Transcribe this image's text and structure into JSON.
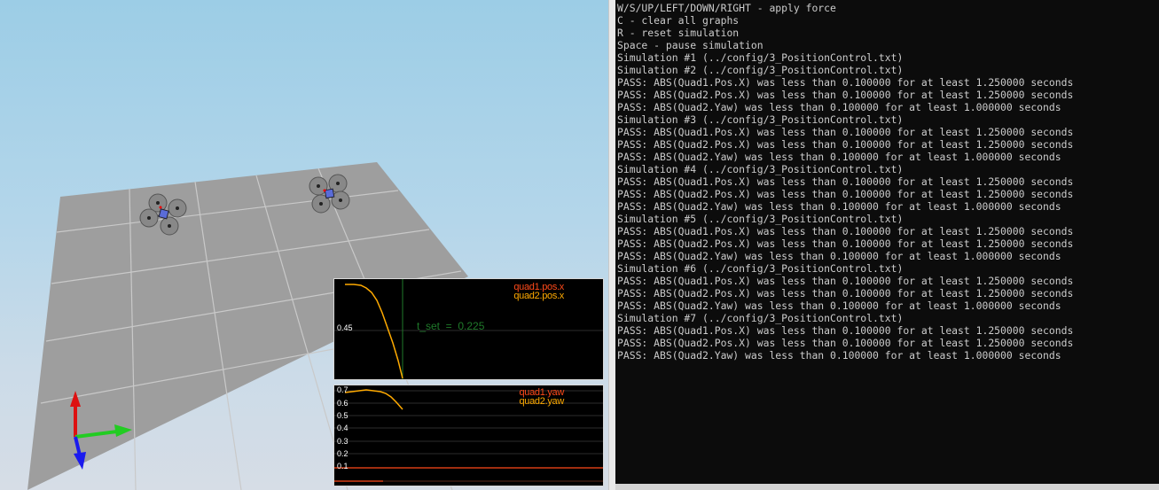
{
  "console": {
    "lines": [
      "W/S/UP/LEFT/DOWN/RIGHT - apply force",
      "C - clear all graphs",
      "R - reset simulation",
      "Space - pause simulation",
      "Simulation #1 (../config/3_PositionControl.txt)",
      "Simulation #2 (../config/3_PositionControl.txt)",
      "PASS: ABS(Quad1.Pos.X) was less than 0.100000 for at least 1.250000 seconds",
      "PASS: ABS(Quad2.Pos.X) was less than 0.100000 for at least 1.250000 seconds",
      "PASS: ABS(Quad2.Yaw) was less than 0.100000 for at least 1.000000 seconds",
      "Simulation #3 (../config/3_PositionControl.txt)",
      "PASS: ABS(Quad1.Pos.X) was less than 0.100000 for at least 1.250000 seconds",
      "PASS: ABS(Quad2.Pos.X) was less than 0.100000 for at least 1.250000 seconds",
      "PASS: ABS(Quad2.Yaw) was less than 0.100000 for at least 1.000000 seconds",
      "Simulation #4 (../config/3_PositionControl.txt)",
      "PASS: ABS(Quad1.Pos.X) was less than 0.100000 for at least 1.250000 seconds",
      "PASS: ABS(Quad2.Pos.X) was less than 0.100000 for at least 1.250000 seconds",
      "PASS: ABS(Quad2.Yaw) was less than 0.100000 for at least 1.000000 seconds",
      "Simulation #5 (../config/3_PositionControl.txt)",
      "PASS: ABS(Quad1.Pos.X) was less than 0.100000 for at least 1.250000 seconds",
      "PASS: ABS(Quad2.Pos.X) was less than 0.100000 for at least 1.250000 seconds",
      "PASS: ABS(Quad2.Yaw) was less than 0.100000 for at least 1.000000 seconds",
      "Simulation #6 (../config/3_PositionControl.txt)",
      "PASS: ABS(Quad1.Pos.X) was less than 0.100000 for at least 1.250000 seconds",
      "PASS: ABS(Quad2.Pos.X) was less than 0.100000 for at least 1.250000 seconds",
      "PASS: ABS(Quad2.Yaw) was less than 0.100000 for at least 1.000000 seconds",
      "Simulation #7 (../config/3_PositionControl.txt)",
      "PASS: ABS(Quad1.Pos.X) was less than 0.100000 for at least 1.250000 seconds",
      "PASS: ABS(Quad2.Pos.X) was less than 0.100000 for at least 1.250000 seconds",
      "PASS: ABS(Quad2.Yaw) was less than 0.100000 for at least 1.000000 seconds"
    ]
  },
  "scene": {
    "floor_color": "#9e9e9e",
    "grid_color": "#c9c9c9",
    "axis_colors": {
      "x": "#22cc22",
      "y": "#dd1111",
      "z": "#1a1aee"
    }
  },
  "plots": {
    "position": {
      "legend": [
        "quad1.pos.x",
        "quad2.pos.x"
      ],
      "tick_label": "0.45",
      "annotation": "t_set  =  0.225",
      "colors": {
        "quad1": "#ff4a1a",
        "quad2": "#ffaa00",
        "t_set": "#1f7a2a"
      }
    },
    "yaw": {
      "legend": [
        "quad1.yaw",
        "quad2.yaw"
      ],
      "ticks": [
        "0.7",
        "0.6",
        "0.5",
        "0.4",
        "0.3",
        "0.2",
        "0.1"
      ],
      "colors": {
        "quad1": "#ff4a1a",
        "quad2": "#ffaa00"
      }
    }
  }
}
